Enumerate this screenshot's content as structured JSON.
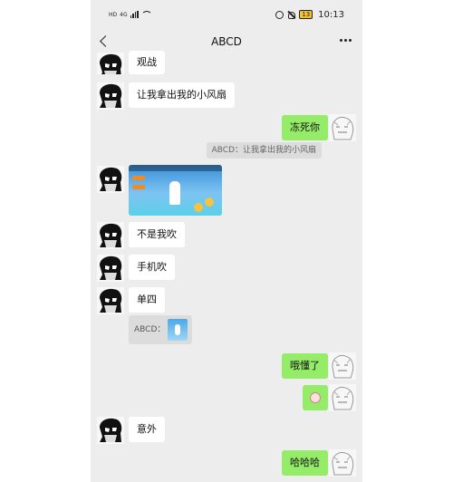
{
  "status_bar": {
    "network": "HD",
    "network_gen": "4G",
    "battery": "13",
    "time": "10:13"
  },
  "header": {
    "title": "ABCD"
  },
  "messages": [
    {
      "side": "in",
      "type": "text",
      "text": "观战"
    },
    {
      "side": "in",
      "type": "text",
      "text": "让我拿出我的小风扇"
    },
    {
      "side": "out",
      "type": "text",
      "text": "冻死你",
      "quote": "ABCD：让我拿出我的小风扇"
    },
    {
      "side": "in",
      "type": "image",
      "image": "game-screenshot"
    },
    {
      "side": "in",
      "type": "text",
      "text": "不是我吹"
    },
    {
      "side": "in",
      "type": "text",
      "text": "手机吹"
    },
    {
      "side": "in",
      "type": "text",
      "text": "单四",
      "quote": "ABCD："
    },
    {
      "side": "out",
      "type": "text",
      "text": "哦懂了"
    },
    {
      "side": "out",
      "type": "sticker",
      "image": "sticker-face"
    },
    {
      "side": "in",
      "type": "text",
      "text": "意外"
    },
    {
      "side": "out",
      "type": "text",
      "text": "哈哈哈"
    }
  ],
  "icons": [
    "back-arrow-icon",
    "more-icon",
    "signal-icon",
    "wifi-icon",
    "alarm-icon",
    "mute-icon",
    "battery-icon"
  ],
  "colors": {
    "chat_background": "#ededed",
    "outgoing_bubble": "#95ec69",
    "incoming_bubble": "#ffffff"
  }
}
